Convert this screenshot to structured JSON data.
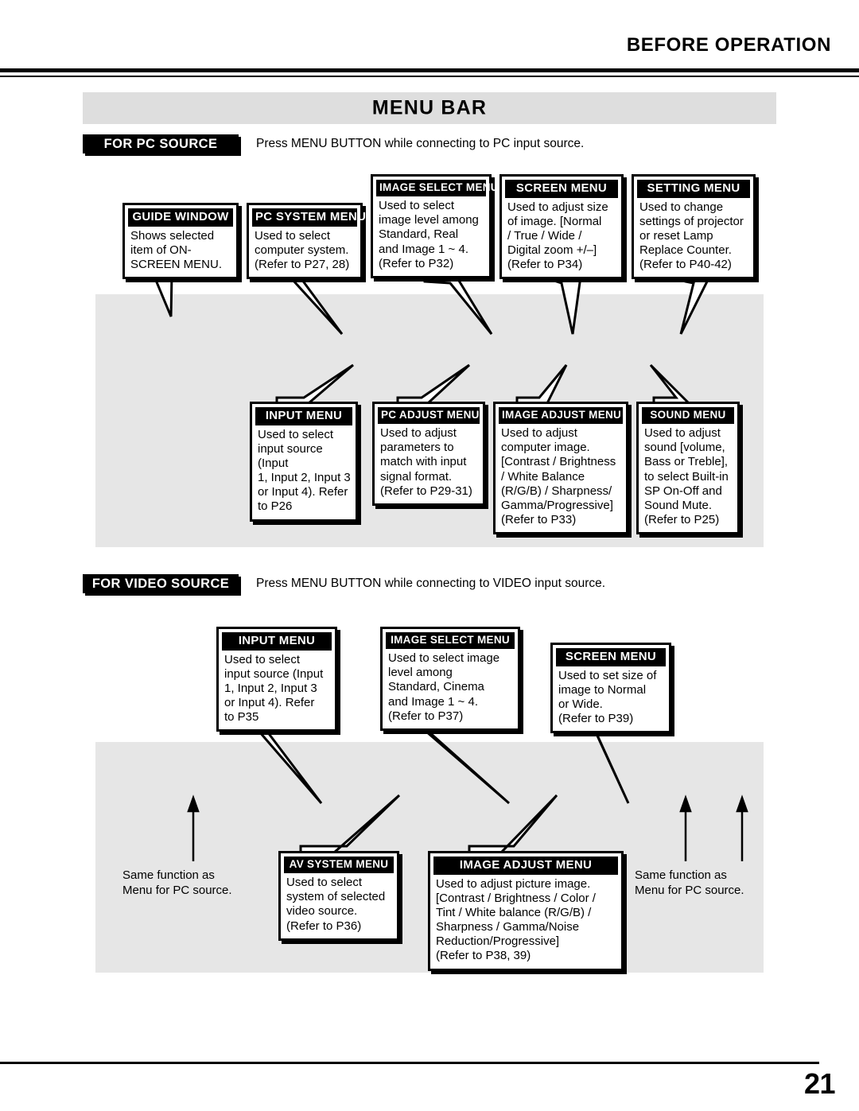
{
  "header": {
    "title": "BEFORE OPERATION"
  },
  "section": {
    "band_title": "MENU BAR"
  },
  "pc_source": {
    "tag": "FOR PC SOURCE",
    "note": "Press MENU BUTTON while connecting to PC input source.",
    "row1": [
      {
        "title": "GUIDE WINDOW",
        "body": "Shows selected\nitem of ON-\nSCREEN MENU."
      },
      {
        "title": "PC SYSTEM MENU",
        "body": "Used to select\ncomputer system.\n(Refer to P27, 28)"
      },
      {
        "title": "IMAGE SELECT MENU",
        "body": "Used to select\nimage level among\nStandard, Real\nand Image 1 ~ 4.\n(Refer to P32)"
      },
      {
        "title": "SCREEN MENU",
        "body": "Used to adjust size\nof image.  [Normal\n/ True / Wide /\nDigital zoom +/–]\n(Refer to P34)"
      },
      {
        "title": "SETTING MENU",
        "body": "Used to change\nsettings of projector\nor reset Lamp\nReplace Counter.\n(Refer to P40-42)"
      }
    ],
    "row2": [
      {
        "title": "INPUT MENU",
        "body": "Used to select\ninput source (Input\n1, Input 2, Input 3\nor Input 4). Refer\nto P26"
      },
      {
        "title": "PC ADJUST MENU",
        "body": "Used to adjust\nparameters to\nmatch with input\nsignal format.\n(Refer to P29-31)"
      },
      {
        "title": "IMAGE ADJUST MENU",
        "body": "Used to adjust\ncomputer image.\n[Contrast / Brightness\n/ White Balance\n(R/G/B) / Sharpness/\nGamma/Progressive]\n(Refer to P33)"
      },
      {
        "title": "SOUND MENU",
        "body": "Used to adjust\nsound [volume,\nBass or Treble],\nto select Built-in\nSP On-Off and\nSound Mute.\n(Refer to P25)"
      }
    ]
  },
  "video_source": {
    "tag": "FOR VIDEO SOURCE",
    "note": "Press MENU BUTTON while connecting to VIDEO input source.",
    "row1": [
      {
        "title": "INPUT MENU",
        "body": "Used to select\ninput source (Input\n1, Input 2, Input 3\nor Input 4). Refer\nto P35"
      },
      {
        "title": "IMAGE SELECT MENU",
        "body": "Used to select image\nlevel among\nStandard, Cinema\nand Image 1 ~ 4.\n(Refer to P37)"
      },
      {
        "title": "SCREEN MENU",
        "body": "Used to set size of\nimage to Normal\nor Wide.\n(Refer to P39)"
      }
    ],
    "row2": [
      {
        "title": "AV SYSTEM MENU",
        "body": "Used to select\nsystem of selected\nvideo source.\n(Refer to P36)"
      },
      {
        "title": "IMAGE ADJUST MENU",
        "body": "Used to adjust picture image.\n[Contrast / Brightness / Color /\nTint / White balance (R/G/B) /\nSharpness / Gamma/Noise\nReduction/Progressive]\n(Refer to P38, 39)"
      }
    ],
    "same_function_left": "Same function as\nMenu for PC source.",
    "same_function_right": "Same function as\nMenu for PC source."
  },
  "footer": {
    "page_number": "21"
  },
  "colors": {
    "band_gray": "#dedede",
    "panel_gray": "#e6e6e6",
    "ink": "#000000",
    "paper": "#ffffff"
  }
}
